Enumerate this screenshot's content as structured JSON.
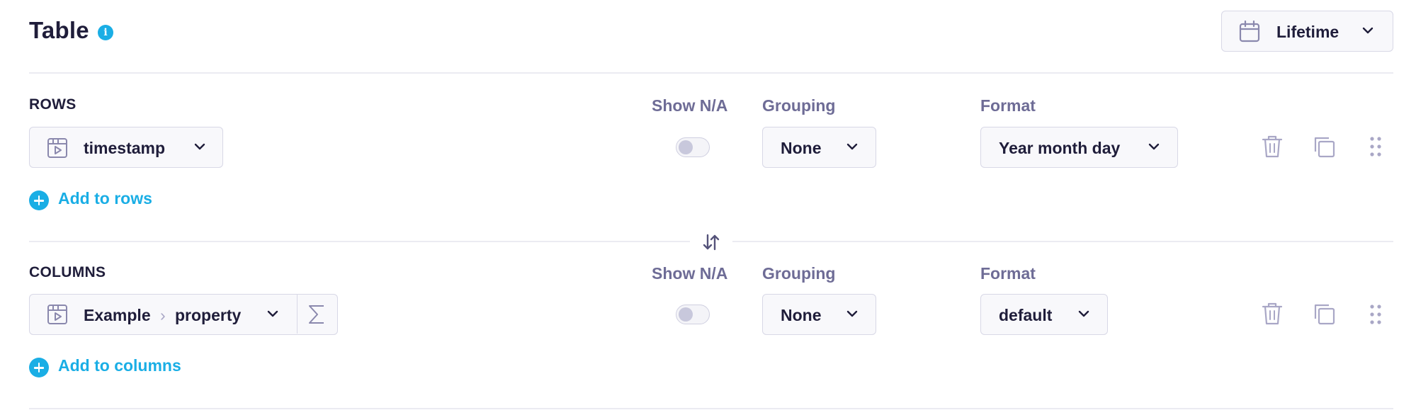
{
  "header": {
    "title": "Table",
    "info_icon": "info-icon",
    "date_range": {
      "label": "Lifetime",
      "icon": "calendar-icon"
    }
  },
  "rows_section": {
    "label": "ROWS",
    "columns": {
      "show_na": "Show N/A",
      "grouping": "Grouping",
      "format": "Format"
    },
    "field": {
      "icon": "dimension-icon",
      "name": "timestamp"
    },
    "show_na_enabled": false,
    "grouping_value": "None",
    "format_value": "Year month day",
    "add_label": "Add to rows"
  },
  "columns_section": {
    "label": "COLUMNS",
    "columns": {
      "show_na": "Show N/A",
      "grouping": "Grouping",
      "format": "Format"
    },
    "field": {
      "icon": "dimension-icon",
      "parent": "Example",
      "separator": "›",
      "name": "property",
      "aggregate_icon": "sigma-icon"
    },
    "show_na_enabled": false,
    "grouping_value": "None",
    "format_value": "default",
    "add_label": "Add to columns"
  },
  "swap_icon": "swap-vertical-icon",
  "colors": {
    "accent": "#1aaee5",
    "text": "#1f1d3a",
    "muted": "#6e6c96",
    "border": "#d8d8e6"
  }
}
